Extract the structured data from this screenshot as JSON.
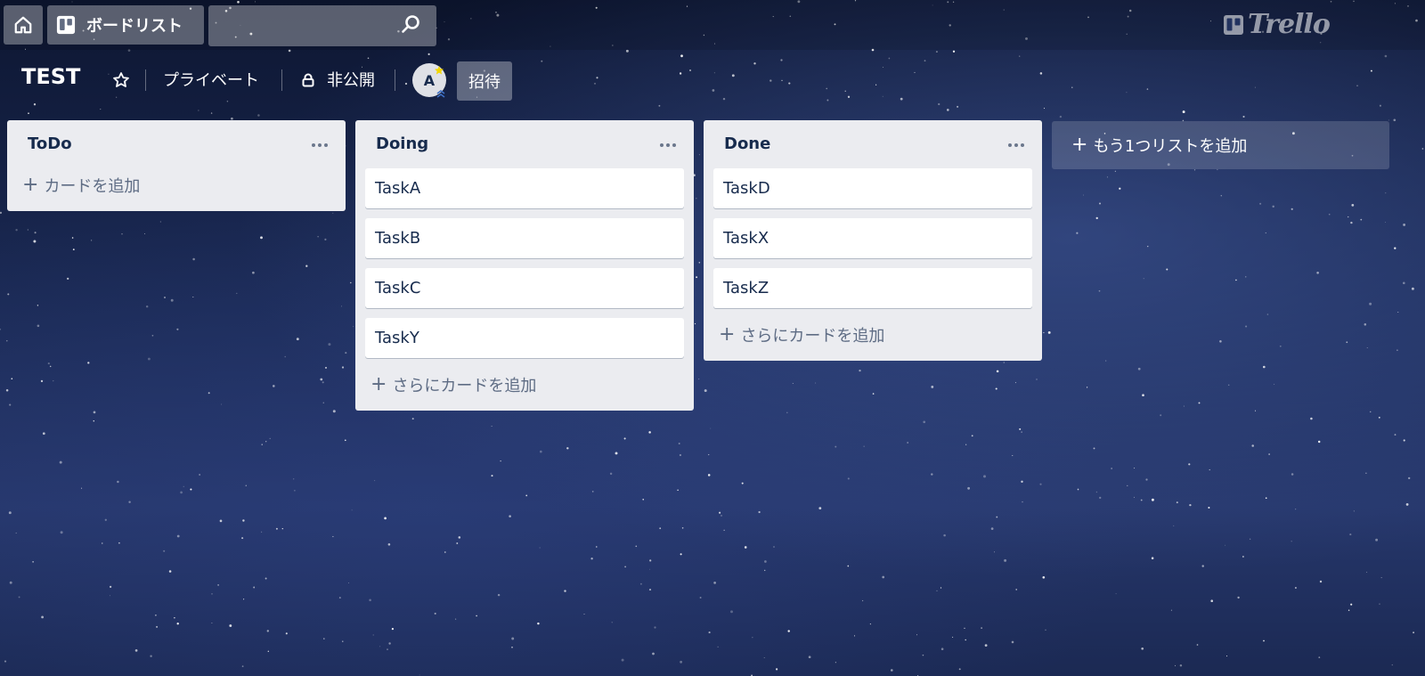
{
  "header": {
    "boards_label": "ボードリスト",
    "search_value": "",
    "logo_text": "Trello"
  },
  "board": {
    "title": "TEST",
    "visibility_label": "プライベート",
    "privacy_label": "非公開",
    "member_initial": "A",
    "invite_label": "招待"
  },
  "lists": [
    {
      "title": "ToDo",
      "cards": [],
      "add_label": "カードを追加"
    },
    {
      "title": "Doing",
      "cards": [
        "TaskA",
        "TaskB",
        "TaskC",
        "TaskY"
      ],
      "add_label": "さらにカードを追加"
    },
    {
      "title": "Done",
      "cards": [
        "TaskD",
        "TaskX",
        "TaskZ"
      ],
      "add_label": "さらにカードを追加"
    }
  ],
  "add_list_label": "もう1つリストを追加",
  "colors": {
    "list_bg": "#ebecf0",
    "card_bg": "#ffffff",
    "text": "#172b4d",
    "muted_text": "#5e6c84",
    "badge": "#f2d600"
  }
}
